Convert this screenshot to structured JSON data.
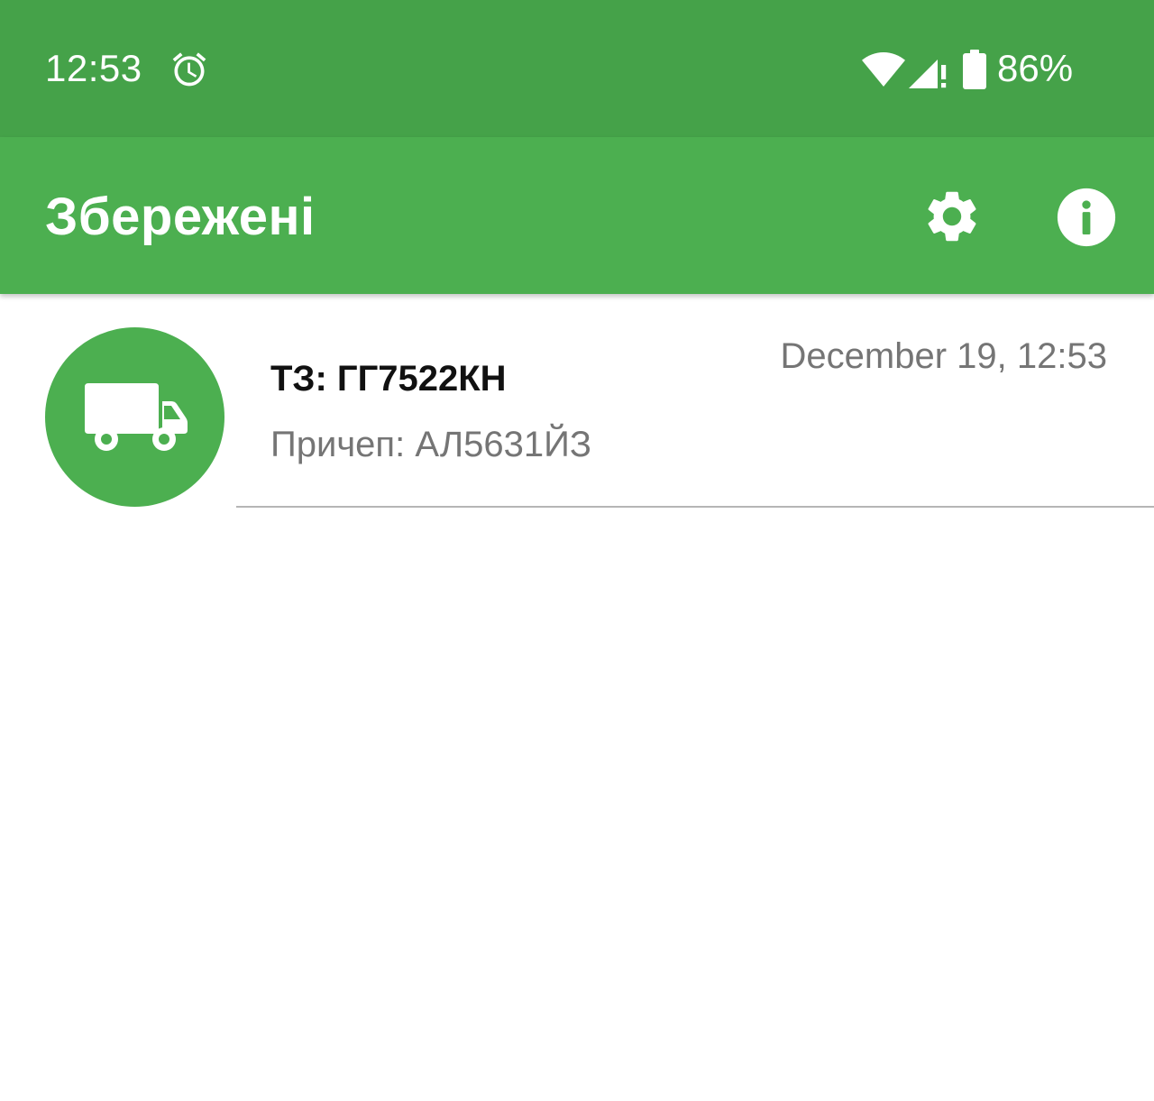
{
  "status_bar": {
    "time": "12:53",
    "battery": "86%",
    "icons": [
      "alarm-icon",
      "wifi-icon",
      "signal-icon",
      "battery-icon"
    ]
  },
  "app_bar": {
    "title": "Збережені",
    "icons": [
      "settings-icon",
      "info-icon"
    ]
  },
  "list": {
    "items": [
      {
        "icon": "truck-icon",
        "title": "ТЗ: ГГ7522КН",
        "subtitle": "Причеп: АЛ5631ЙЗ",
        "date": "December 19, 12:53"
      }
    ]
  },
  "colors": {
    "status_bar": "#45a249",
    "app_bar": "#4caf50",
    "avatar": "#4caf50",
    "subtitle_text": "#757575",
    "title_text": "#111111"
  }
}
